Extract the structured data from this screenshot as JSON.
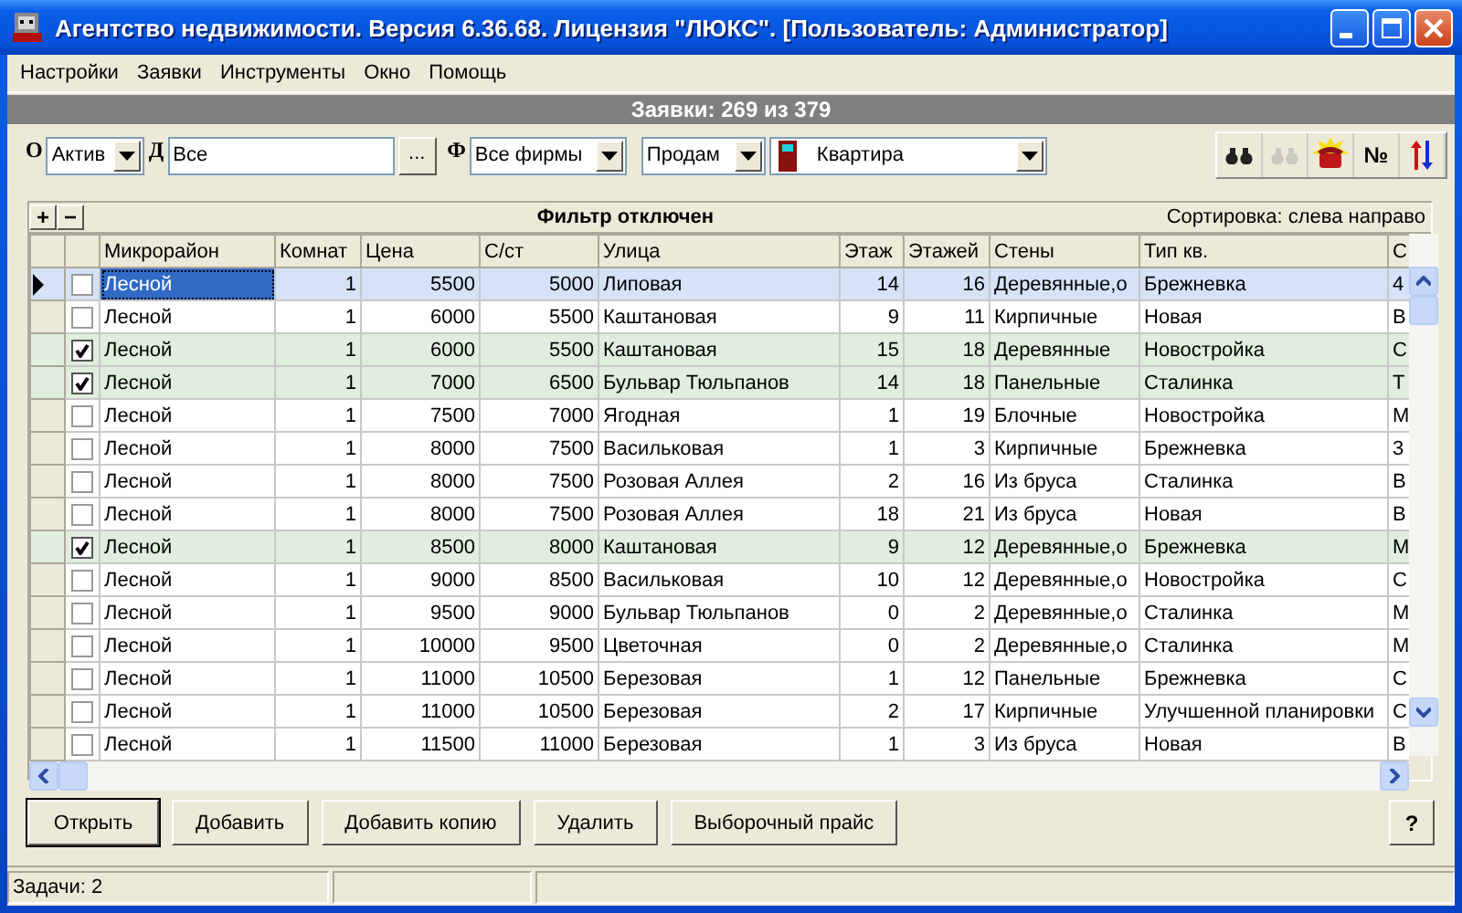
{
  "window": {
    "title": "Агентство недвижимости. Версия 6.36.68. Лицензия \"ЛЮКС\". [Пользователь: Администратор]"
  },
  "menu": [
    "Настройки",
    "Заявки",
    "Инструменты",
    "Окно",
    "Помощь"
  ],
  "counter": "Заявки: 269 из 379",
  "filters": {
    "status_label": "О",
    "status": "Актив",
    "date_label": "Д",
    "date": "Все",
    "date_button": "...",
    "firm_label": "Ф",
    "firm": "Все фирмы",
    "deal": "Продам",
    "property": "Квартира"
  },
  "toolbar": [
    {
      "kind": "binoculars",
      "disabled": false
    },
    {
      "kind": "binoculars",
      "disabled": true
    },
    {
      "kind": "phone",
      "disabled": false
    },
    {
      "kind": "text",
      "label": "№",
      "disabled": false
    },
    {
      "kind": "sort",
      "disabled": false
    }
  ],
  "grid": {
    "add": "+",
    "remove": "−",
    "filter_status": "Фильтр отключен",
    "sorting": "Сортировка: слева направо",
    "columns": [
      "Микрорайон",
      "Комнат",
      "Цена",
      "С/ст",
      "Улица",
      "Этаж",
      "Этажей",
      "Стены",
      "Тип кв.",
      "С"
    ],
    "rows": [
      {
        "selected": true,
        "checked": false,
        "cells": [
          "Лесной",
          "1",
          "5500",
          "5000",
          "Липовая",
          "14",
          "16",
          "Деревянные,о",
          "Брежневка",
          "4"
        ]
      },
      {
        "selected": false,
        "checked": false,
        "cells": [
          "Лесной",
          "1",
          "6000",
          "5500",
          "Каштановая",
          "9",
          "11",
          "Кирпичные",
          "Новая",
          "В"
        ]
      },
      {
        "selected": false,
        "checked": true,
        "cells": [
          "Лесной",
          "1",
          "6000",
          "5500",
          "Каштановая",
          "15",
          "18",
          "Деревянные",
          "Новостройка",
          "С"
        ]
      },
      {
        "selected": false,
        "checked": true,
        "cells": [
          "Лесной",
          "1",
          "7000",
          "6500",
          "Бульвар Тюльпанов",
          "14",
          "18",
          "Панельные",
          "Сталинка",
          "Т"
        ]
      },
      {
        "selected": false,
        "checked": false,
        "cells": [
          "Лесной",
          "1",
          "7500",
          "7000",
          "Ягодная",
          "1",
          "19",
          "Блочные",
          "Новостройка",
          "М"
        ]
      },
      {
        "selected": false,
        "checked": false,
        "cells": [
          "Лесной",
          "1",
          "8000",
          "7500",
          "Васильковая",
          "1",
          "3",
          "Кирпичные",
          "Брежневка",
          "3"
        ]
      },
      {
        "selected": false,
        "checked": false,
        "cells": [
          "Лесной",
          "1",
          "8000",
          "7500",
          "Розовая Аллея",
          "2",
          "16",
          "Из бруса",
          "Сталинка",
          "В"
        ]
      },
      {
        "selected": false,
        "checked": false,
        "cells": [
          "Лесной",
          "1",
          "8000",
          "7500",
          "Розовая Аллея",
          "18",
          "21",
          "Из бруса",
          "Новая",
          "В"
        ]
      },
      {
        "selected": false,
        "checked": true,
        "cells": [
          "Лесной",
          "1",
          "8500",
          "8000",
          "Каштановая",
          "9",
          "12",
          "Деревянные,о",
          "Брежневка",
          "М"
        ]
      },
      {
        "selected": false,
        "checked": false,
        "cells": [
          "Лесной",
          "1",
          "9000",
          "8500",
          "Васильковая",
          "10",
          "12",
          "Деревянные,о",
          "Новостройка",
          "С"
        ]
      },
      {
        "selected": false,
        "checked": false,
        "cells": [
          "Лесной",
          "1",
          "9500",
          "9000",
          "Бульвар Тюльпанов",
          "0",
          "2",
          "Деревянные,о",
          "Сталинка",
          "М"
        ]
      },
      {
        "selected": false,
        "checked": false,
        "cells": [
          "Лесной",
          "1",
          "10000",
          "9500",
          "Цветочная",
          "0",
          "2",
          "Деревянные,о",
          "Сталинка",
          "М"
        ]
      },
      {
        "selected": false,
        "checked": false,
        "cells": [
          "Лесной",
          "1",
          "11000",
          "10500",
          "Березовая",
          "1",
          "12",
          "Панельные",
          "Брежневка",
          "С"
        ]
      },
      {
        "selected": false,
        "checked": false,
        "cells": [
          "Лесной",
          "1",
          "11000",
          "10500",
          "Березовая",
          "2",
          "17",
          "Кирпичные",
          "Улучшенной планировки",
          "С"
        ]
      },
      {
        "selected": false,
        "checked": false,
        "cells": [
          "Лесной",
          "1",
          "11500",
          "11000",
          "Березовая",
          "1",
          "3",
          "Из бруса",
          "Новая",
          "В"
        ]
      }
    ]
  },
  "buttons": [
    {
      "label": "Открыть",
      "default": true
    },
    {
      "label": "Добавить",
      "default": false
    },
    {
      "label": "Добавить копию",
      "default": false
    },
    {
      "label": "Удалить",
      "default": false
    },
    {
      "label": "Выборочный прайс",
      "default": false
    }
  ],
  "help": "?",
  "status_bar": [
    "Задачи: 2"
  ]
}
